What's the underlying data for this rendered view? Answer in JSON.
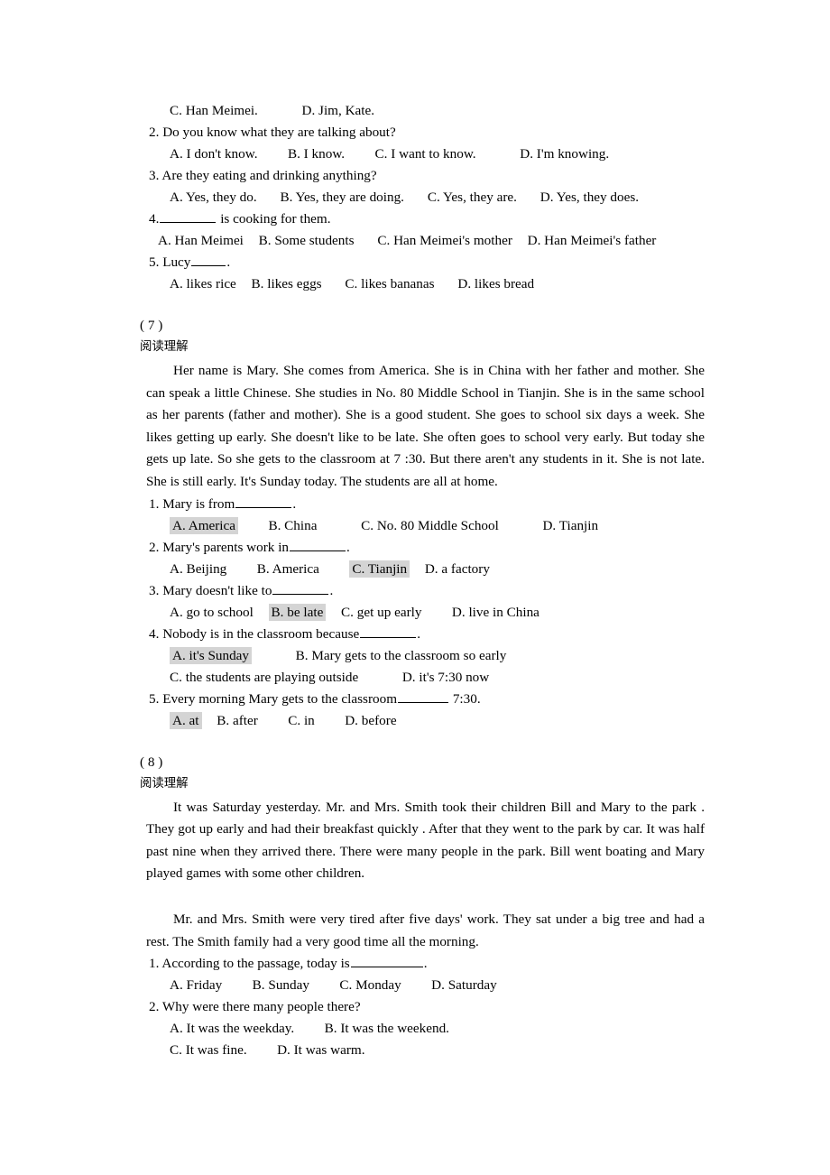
{
  "document": {
    "continued_questions": {
      "q1_options_tail": {
        "c": "C. Han Meimei.",
        "d": "D. Jim, Kate."
      },
      "items": [
        {
          "stem": "2. Do you know what they are talking about?",
          "options": [
            "A. I don't know.",
            "B. I know.",
            "C. I want to know.",
            "D. I'm knowing."
          ]
        },
        {
          "stem": "3. Are they eating and drinking anything?",
          "options": [
            "A. Yes, they do.",
            "B. Yes, they are doing.",
            "C. Yes, they are.",
            "D. Yes, they does."
          ]
        },
        {
          "stem_prefix": "4.",
          "stem_suffix": " is cooking for them.",
          "options": [
            "A. Han Meimei",
            "B. Some students",
            "C. Han Meimei's mother",
            "D. Han Meimei's father"
          ]
        },
        {
          "stem_prefix": "5. Lucy",
          "stem_suffix": ".",
          "options": [
            "A. likes rice",
            "B. likes eggs",
            "C. likes bananas",
            "D. likes bread"
          ]
        }
      ]
    },
    "sections": [
      {
        "number": "( 7  )",
        "label": "阅读理解",
        "passages": [
          "Her name is Mary. She comes from America. She is in China with her father and mother. She can speak a little Chinese. She studies in No. 80 Middle School in Tianjin. She is in the same school as her parents (father and mother). She is a good student. She goes to school six days a week. She likes getting up early. She doesn't like to be late. She often goes to school very early. But today she gets up late. So she gets to the classroom at 7 :30. But there aren't any students in it. She is not late. She is still early. It's Sunday today. The students are all at home."
        ],
        "questions": [
          {
            "stem_prefix": "1. Mary is from",
            "stem_suffix": ".",
            "options": [
              {
                "text": "A. America",
                "selected": true
              },
              {
                "text": "B. China",
                "selected": false
              },
              {
                "text": "C. No. 80 Middle School",
                "selected": false
              },
              {
                "text": "D. Tianjin",
                "selected": false
              }
            ]
          },
          {
            "stem_prefix": "2. Mary's parents work in",
            "stem_suffix": ".",
            "options": [
              {
                "text": "A. Beijing",
                "selected": false
              },
              {
                "text": "B. America",
                "selected": false
              },
              {
                "text": "C. Tianjin",
                "selected": true
              },
              {
                "text": "D. a factory",
                "selected": false
              }
            ]
          },
          {
            "stem_prefix": "3. Mary doesn't like to",
            "stem_suffix": ".",
            "options": [
              {
                "text": "A. go to school",
                "selected": false
              },
              {
                "text": "B. be late",
                "selected": true
              },
              {
                "text": "C. get up early",
                "selected": false
              },
              {
                "text": "D. live in China",
                "selected": false
              }
            ]
          },
          {
            "stem_prefix": "4. Nobody is in the classroom because",
            "stem_suffix": ".",
            "options": [
              {
                "text": "A. it's Sunday",
                "selected": true
              },
              {
                "text": "B. Mary gets to the classroom so early",
                "selected": false
              },
              {
                "text": "C. the students are playing outside",
                "selected": false
              },
              {
                "text": "D. it's 7:30 now",
                "selected": false
              }
            ]
          },
          {
            "stem_prefix": "5. Every morning Mary gets to the classroom",
            "stem_suffix": " 7:30.",
            "options": [
              {
                "text": "A. at",
                "selected": true
              },
              {
                "text": "B. after",
                "selected": false
              },
              {
                "text": "C. in",
                "selected": false
              },
              {
                "text": "D. before",
                "selected": false
              }
            ]
          }
        ]
      },
      {
        "number": "( 8  )",
        "label": "阅读理解",
        "passages": [
          "It was Saturday yesterday. Mr. and Mrs. Smith took their children Bill and Mary to the park . They got up early and had their breakfast quickly . After that they went to the park by car. It was half past nine when they arrived there. There were many people in the park. Bill went boating and Mary played games with some other children.",
          "Mr. and Mrs. Smith were very tired after five days' work. They sat under a big tree and had a rest. The Smith family had a very good time all the morning."
        ],
        "questions": [
          {
            "stem_prefix": "1. According to the passage, today is",
            "stem_suffix": ".",
            "options": [
              {
                "text": "A. Friday",
                "selected": false
              },
              {
                "text": "B. Sunday",
                "selected": false
              },
              {
                "text": "C. Monday",
                "selected": false
              },
              {
                "text": "D. Saturday",
                "selected": false
              }
            ]
          },
          {
            "stem": "2. Why were there many people there?",
            "options": [
              {
                "text": "A. It was the weekday.",
                "selected": false
              },
              {
                "text": "B. It was the weekend.",
                "selected": false
              },
              {
                "text": "C. It was fine.",
                "selected": false
              },
              {
                "text": "D. It was warm.",
                "selected": false
              }
            ]
          }
        ]
      }
    ],
    "colors": {
      "highlight": "#d4d4d4",
      "text": "#000000",
      "background": "#ffffff"
    }
  }
}
